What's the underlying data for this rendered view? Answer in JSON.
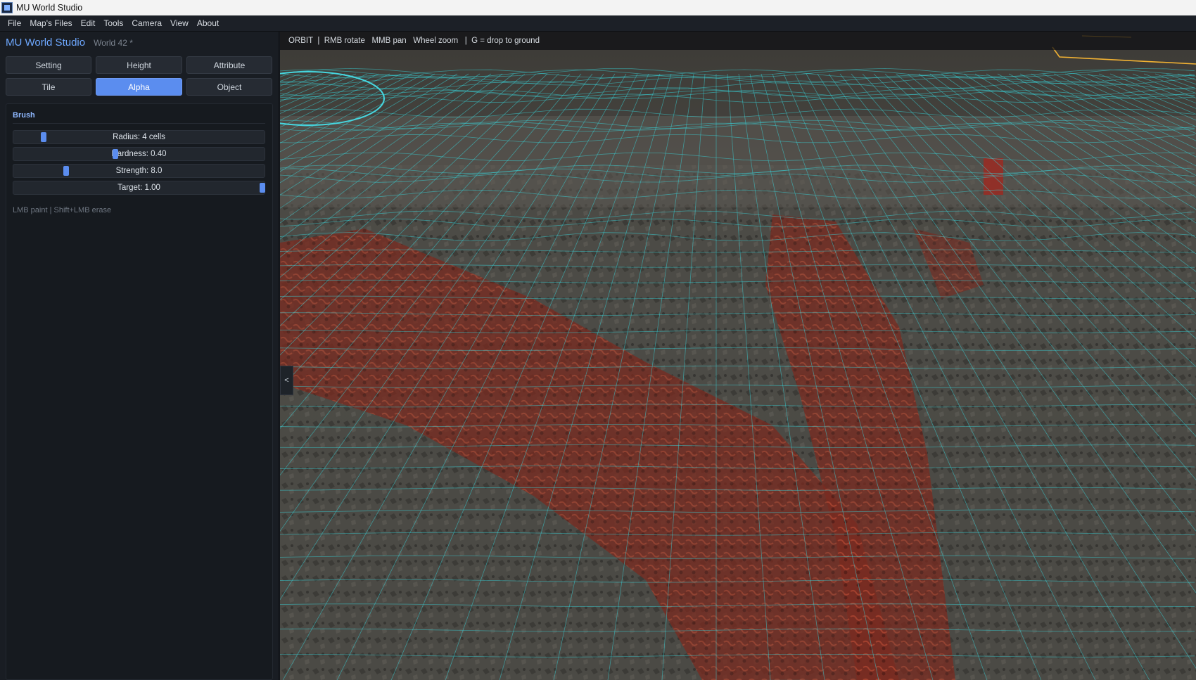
{
  "window": {
    "title": "MU World Studio"
  },
  "menu": [
    "File",
    "Map's Files",
    "Edit",
    "Tools",
    "Camera",
    "View",
    "About"
  ],
  "sidebar": {
    "brand": "MU World Studio",
    "world": "World 42 *",
    "modes": [
      {
        "label": "Setting",
        "active": false
      },
      {
        "label": "Height",
        "active": false
      },
      {
        "label": "Attribute",
        "active": false
      },
      {
        "label": "Tile",
        "active": false
      },
      {
        "label": "Alpha",
        "active": true
      },
      {
        "label": "Object",
        "active": false
      }
    ],
    "brush": {
      "title": "Brush",
      "sliders": [
        {
          "label": "Radius: 4 cells",
          "fraction": 0.11
        },
        {
          "label": "Hardness: 0.40",
          "fraction": 0.4
        },
        {
          "label": "Strength: 8.0",
          "fraction": 0.2
        },
        {
          "label": "Target: 1.00",
          "fraction": 1.0
        }
      ],
      "hint": "LMB paint  |  Shift+LMB erase"
    }
  },
  "viewport": {
    "status": "ORBIT  |  RMB rotate   MMB pan   Wheel zoom   |  G = drop to ground",
    "collapse_label": "<",
    "colors": {
      "grid": "#39d3d8",
      "brush_ring": "#46d7e0",
      "selection": "#f2b233",
      "ground": "#4a4a45",
      "paint": "#8a2a20"
    }
  }
}
